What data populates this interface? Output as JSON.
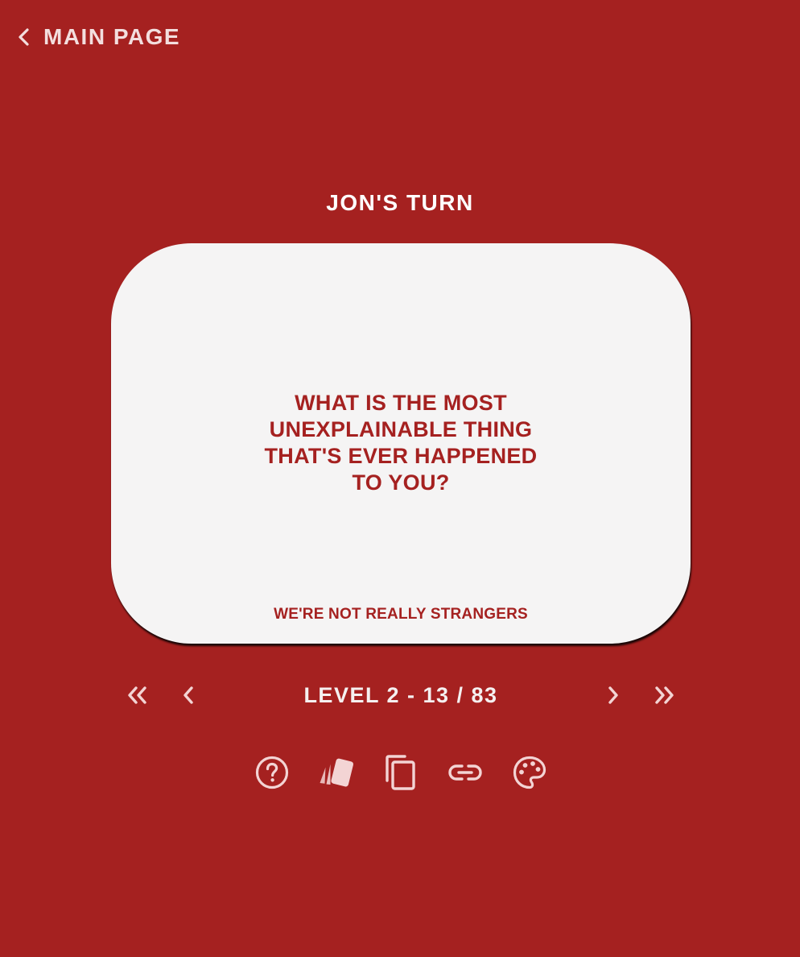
{
  "header": {
    "back_label": "MAIN PAGE",
    "back_icon": "chevron-left-icon"
  },
  "game": {
    "turn_label": "JON'S TURN",
    "card": {
      "question": "WHAT IS THE MOST UNEXPLAINABLE THING THAT'S EVER HAPPENED TO YOU?",
      "brand": "WE'RE NOT REALLY STRANGERS"
    },
    "progress": "LEVEL 2 - 13 / 83"
  },
  "navigation": {
    "icons": [
      "double-chevron-left-icon",
      "chevron-left-icon",
      "chevron-right-icon",
      "double-chevron-right-icon"
    ]
  },
  "toolbar": {
    "icons": [
      "help-icon",
      "cards-icon",
      "copy-icon",
      "link-icon",
      "palette-icon"
    ]
  },
  "colors": {
    "background": "#a52120",
    "card": "#f5f4f4",
    "accent_text": "#a52120",
    "icon": "#f3d4d4"
  }
}
